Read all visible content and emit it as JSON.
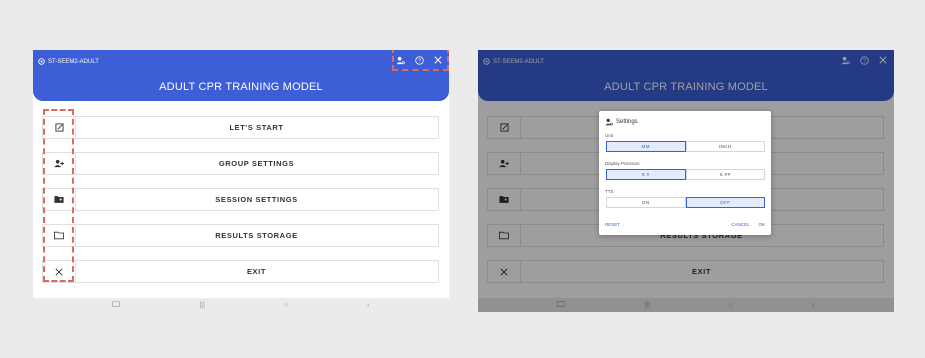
{
  "app": {
    "small_title": "ST-SEEM2-ADULT",
    "main_title": "ADULT CPR TRAINING MODEL",
    "header_color": "#3d5ed7",
    "top_icons": [
      "settings-person-icon",
      "help-icon",
      "close-icon"
    ]
  },
  "menu": {
    "items": [
      {
        "label": "LET'S START",
        "icon": "edit-icon"
      },
      {
        "label": "GROUP SETTINGS",
        "icon": "group-add-icon"
      },
      {
        "label": "SESSION SETTINGS",
        "icon": "folder-shared-icon"
      },
      {
        "label": "RESULTS STORAGE",
        "icon": "folder-icon"
      },
      {
        "label": "EXIT",
        "icon": "close-icon"
      }
    ],
    "right_visible_partial": "RESULTS STORAGE"
  },
  "navbar": {
    "buttons": [
      "screenshot-icon",
      "|||",
      "○",
      "‹"
    ]
  },
  "settings_dialog": {
    "title": "Settings",
    "unit_label": "Unit",
    "unit_options": [
      "MM",
      "INCH"
    ],
    "unit_selected": "MM",
    "precision_label": "Display Precision",
    "precision_options": [
      "0.#",
      "0.##"
    ],
    "precision_selected": "0.#",
    "tts_label": "TTS",
    "tts_options": [
      "ON",
      "OFF"
    ],
    "tts_selected": "OFF",
    "reset_label": "RESET",
    "cancel_label": "CANCEL",
    "ok_label": "OK"
  },
  "highlight_color": "#d86a6a"
}
